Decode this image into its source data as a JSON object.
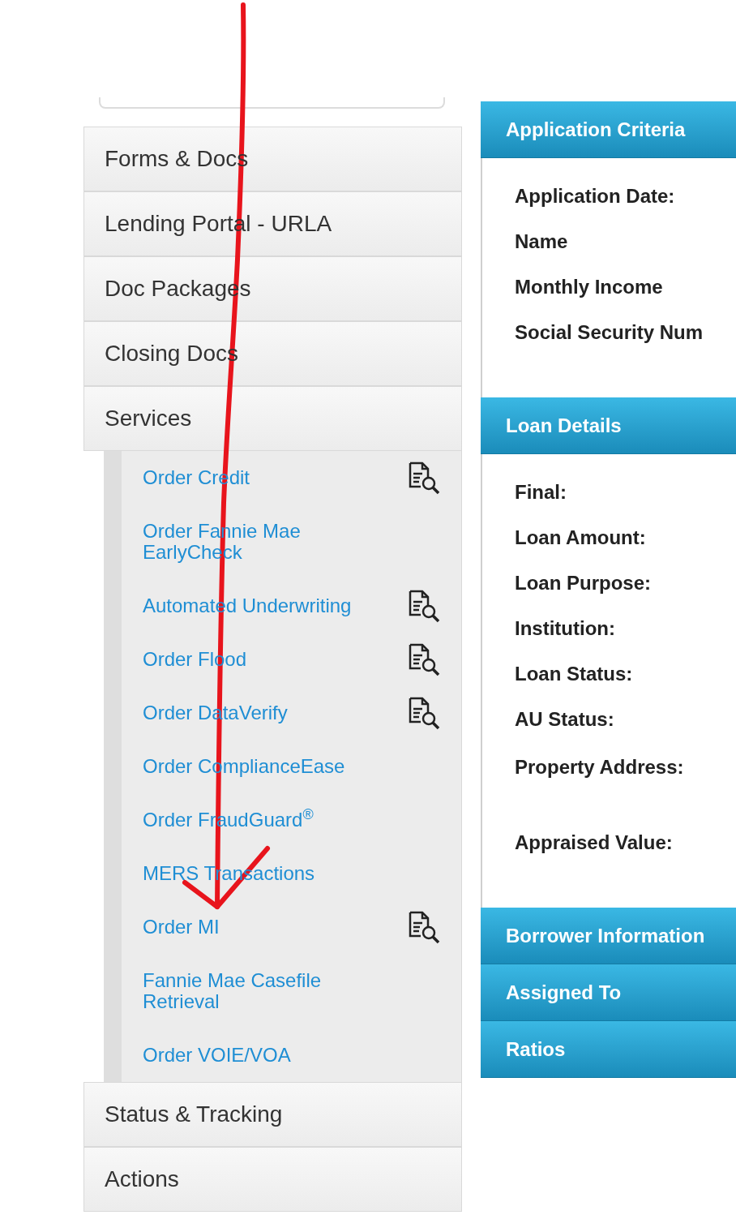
{
  "sidebar": {
    "sections": [
      {
        "label": "Forms & Docs"
      },
      {
        "label": "Lending Portal - URLA"
      },
      {
        "label": "Doc Packages"
      },
      {
        "label": "Closing Docs"
      },
      {
        "label": "Services",
        "items": [
          {
            "label": "Order Credit",
            "kind": "preview"
          },
          {
            "label": "Order Fannie Mae EarlyCheck",
            "kind": "link"
          },
          {
            "label": "Automated Underwriting",
            "kind": "preview"
          },
          {
            "label": "Order Flood",
            "kind": "preview"
          },
          {
            "label": "Order DataVerify",
            "kind": "preview"
          },
          {
            "label": "Order ComplianceEase",
            "kind": "link"
          },
          {
            "label": "Order FraudGuard$^{®}$",
            "kind": "link"
          },
          {
            "label": "MERS Transactions",
            "kind": "link"
          },
          {
            "label": "Order MI",
            "kind": "preview"
          },
          {
            "label": "Fannie Mae Casefile Retrieval",
            "kind": "link"
          },
          {
            "label": "Order VOIE/VOA",
            "kind": "link"
          }
        ]
      },
      {
        "label": "Status & Tracking"
      },
      {
        "label": "Actions"
      }
    ]
  },
  "panels": [
    {
      "title": "Application Criteria",
      "fields": [
        {
          "label": "Application Date:",
          "kind": "line"
        },
        {
          "label": "Name",
          "kind": "line"
        },
        {
          "label": "Monthly Income",
          "kind": "line"
        },
        {
          "label": "Social Security Num",
          "kind": "line"
        }
      ]
    },
    {
      "title": "Loan Details",
      "fields": [
        {
          "label": "Final:",
          "kind": "line"
        },
        {
          "label": "Loan Amount:",
          "kind": "line"
        },
        {
          "label": "Loan Purpose:",
          "kind": "line"
        },
        {
          "label": "Institution:",
          "kind": "line"
        },
        {
          "label": "Loan Status:",
          "kind": "line"
        },
        {
          "label": "AU Status:",
          "kind": "line"
        },
        {
          "label": "Property Address:",
          "kind": "address"
        },
        {
          "label": "Appraised Value:",
          "kind": "line"
        }
      ]
    },
    {
      "title": "Borrower Information"
    },
    {
      "title": "Assigned To"
    },
    {
      "title": "Ratios"
    }
  ]
}
